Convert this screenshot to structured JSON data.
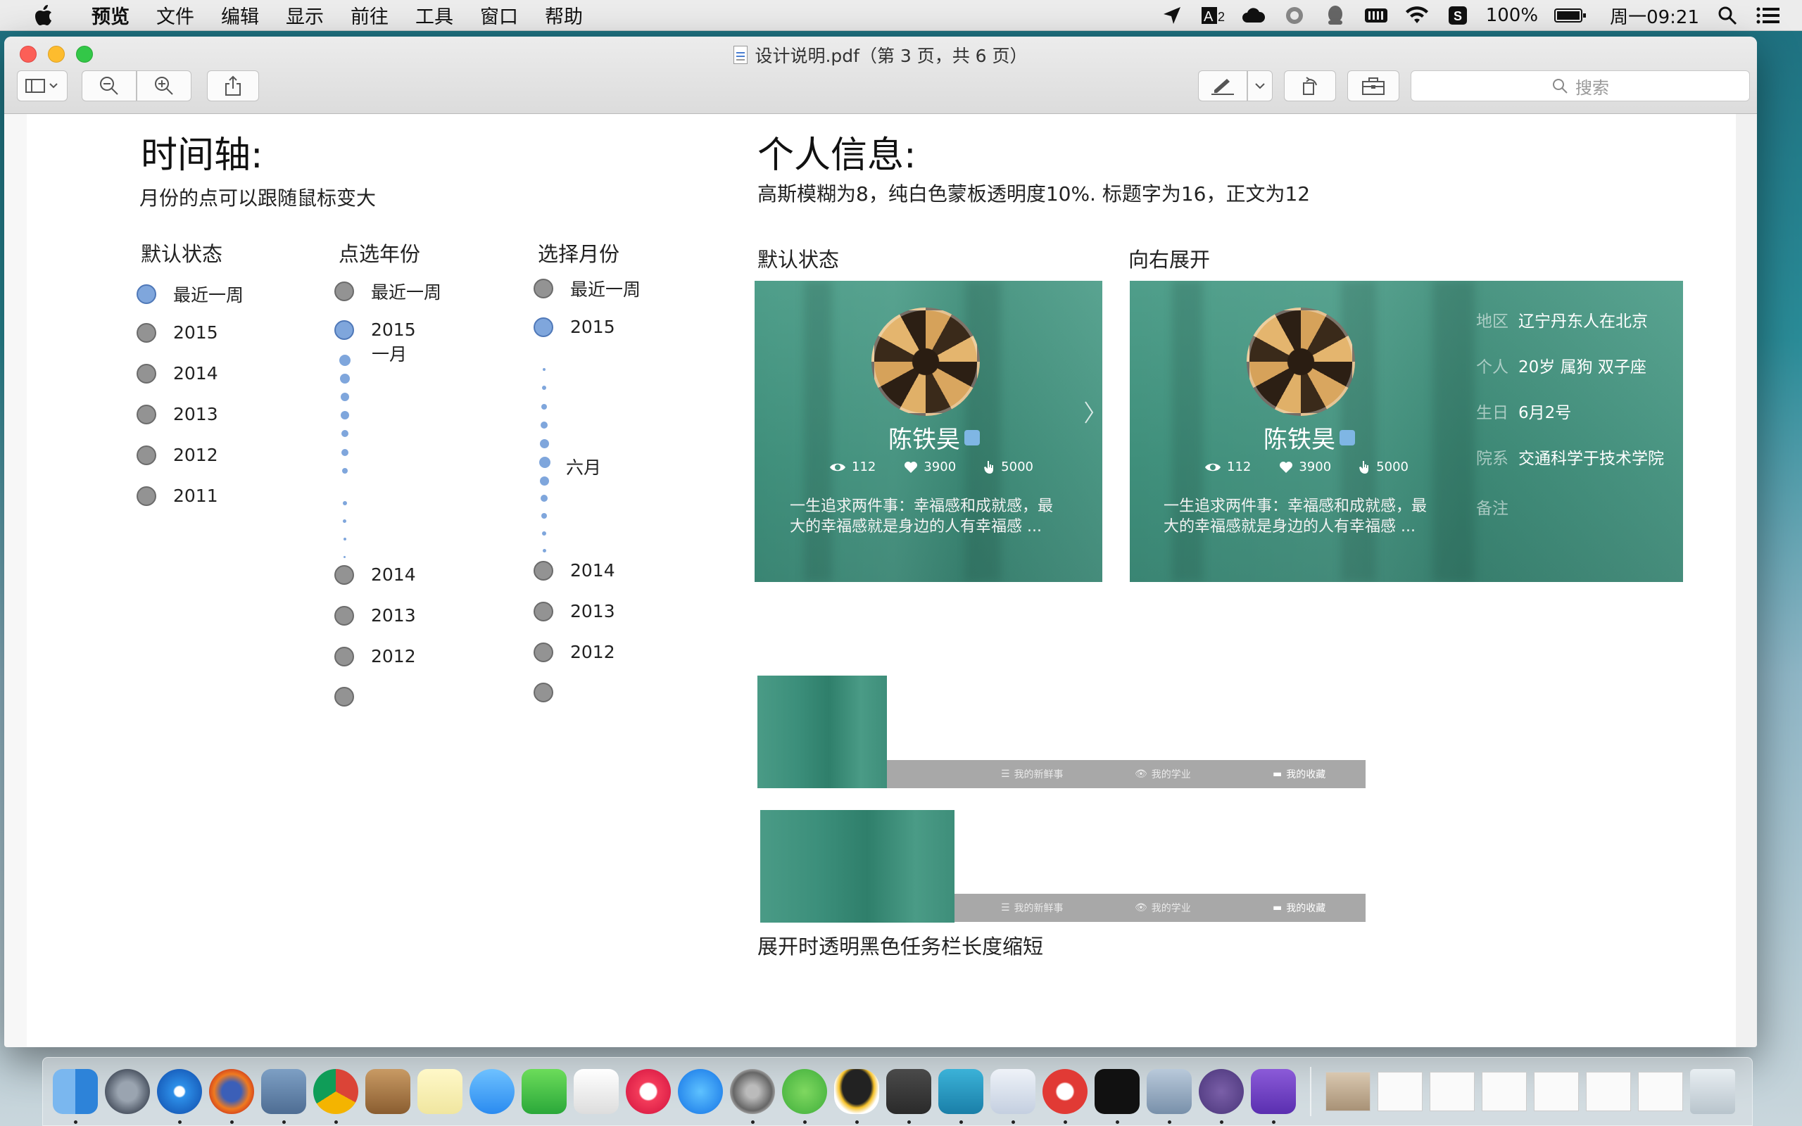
{
  "menubar": {
    "app": "预览",
    "items": [
      "文件",
      "编辑",
      "显示",
      "前往",
      "工具",
      "窗口",
      "帮助"
    ],
    "battery": "100%",
    "clock": "周一09:21"
  },
  "window": {
    "title": "设计说明.pdf（第 3 页，共 6 页）",
    "search_placeholder": "搜索"
  },
  "timeline": {
    "heading": "时间轴:",
    "subtitle": "月份的点可以跟随鼠标变大",
    "col1": {
      "title": "默认状态",
      "items": [
        "最近一周",
        "2015",
        "2014",
        "2013",
        "2012",
        "2011"
      ]
    },
    "col2": {
      "title": "点选年份",
      "top": [
        "最近一周",
        "2015"
      ],
      "month": "一月",
      "bottom": [
        "2014",
        "2013",
        "2012",
        ""
      ]
    },
    "col3": {
      "title": "选择月份",
      "top": [
        "最近一周",
        "2015"
      ],
      "month": "六月",
      "bottom": [
        "2014",
        "2013",
        "2012",
        ""
      ]
    }
  },
  "profile": {
    "heading": "个人信息:",
    "subtitle": "高斯模糊为8，纯白色蒙板透明度10%. 标题字为16，正文为12",
    "default_label": "默认状态",
    "expand_label": "向右展开",
    "name": "陈铁昊",
    "views": "112",
    "likes": "3900",
    "clicks": "5000",
    "bio_line1": "一生追求两件事：幸福感和成就感，最",
    "bio_line2": "大的幸福感就是身边的人有幸福感 ...",
    "info": [
      {
        "key": "地区",
        "value": "辽宁丹东人在北京"
      },
      {
        "key": "个人",
        "value": "20岁 属狗 双子座"
      },
      {
        "key": "生日",
        "value": "6月2号"
      },
      {
        "key": "院系",
        "value": "交通科学于技术学院"
      },
      {
        "key": "备注",
        "value": ""
      }
    ]
  },
  "taskbar": {
    "items": [
      "我的新鲜事",
      "我的学业",
      "我的收藏"
    ],
    "caption": "展开时透明黑色任务栏长度缩短"
  },
  "colors": {
    "card_green": "#3f8f7b",
    "dot_active": "#7fa6dc",
    "dot_default": "#939393"
  }
}
